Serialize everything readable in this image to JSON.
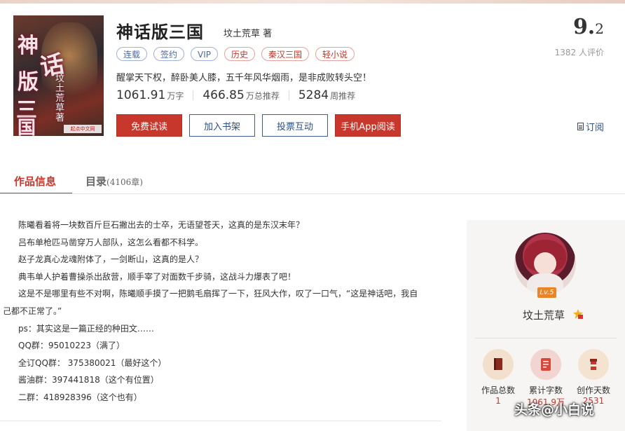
{
  "book": {
    "cover_title_chars": [
      "神",
      "话",
      "版",
      "三",
      "国"
    ],
    "cover_author": "坟土荒草著",
    "cover_publisher": "起点中文网",
    "title": "神话版三国",
    "author_line": "坟土荒草 著",
    "score_int": "9.",
    "score_dec": "2",
    "rating_count": "1382 人评价",
    "tags": [
      {
        "label": "连载",
        "style": "blue"
      },
      {
        "label": "签约",
        "style": "blue"
      },
      {
        "label": "VIP",
        "style": "blue"
      },
      {
        "label": "历史",
        "style": "red"
      },
      {
        "label": "秦汉三国",
        "style": "red"
      },
      {
        "label": "轻小说",
        "style": "red"
      }
    ],
    "intro": "醒掌天下权，醉卧美人膝，五千年风华烟雨，是非成败转头空！",
    "stats": [
      {
        "num": "1061.91",
        "unit": "万字"
      },
      {
        "num": "466.85",
        "unit": "万总推荐"
      },
      {
        "num": "5284",
        "unit": "周推荐"
      }
    ],
    "buttons": {
      "free_trial": "免费试读",
      "add_shelf": "加入书架",
      "vote": "投票互动",
      "app_read": "手机App阅读"
    },
    "subscribe": "订阅"
  },
  "tabs": {
    "info": "作品信息",
    "catalog": "目录",
    "catalog_count": "(4106章)"
  },
  "description": [
    "陈曦看着将一块数百斤巨石撇出去的士卒，无语望苍天，这真的是东汉末年？",
    "吕布单枪匹马凿穿万人部队，这怎么看都不科学。",
    "赵子龙真心龙魂附体了，一剑断山，这真的是人？",
    "典韦单人护着曹操杀出敌营，顺手宰了对面数千步骑，这战斗力爆表了吧！",
    "这是不是哪里有些不对啊，陈曦顺手摸了一把鹅毛扇挥了一下，狂风大作，叹了一口气，“这是神话吧，我自",
    "己都不正常了。”",
    "ps：其实这是一篇正经的种田文……",
    "QQ群：95010223（满了）",
    "全订QQ群： 375380021（最好这个）",
    "酱油群：397441818（这个有位置）",
    "二群：418928396（这个也有）"
  ],
  "author_panel": {
    "level": "Lv.5",
    "name": "坟土荒草",
    "stats": [
      {
        "label": "作品总数",
        "value": "1",
        "color": "#f3e0cc",
        "icon": "book-icon"
      },
      {
        "label": "累计字数",
        "value": "1061.9万",
        "color": "#f2d4d0",
        "icon": "document-icon"
      },
      {
        "label": "创作天数",
        "value": "2531",
        "color": "#f5e3d2",
        "icon": "cup-icon"
      }
    ]
  },
  "watermark": "头条@小白说",
  "colors": {
    "accent": "#c8372b",
    "link": "#2c4f82"
  }
}
